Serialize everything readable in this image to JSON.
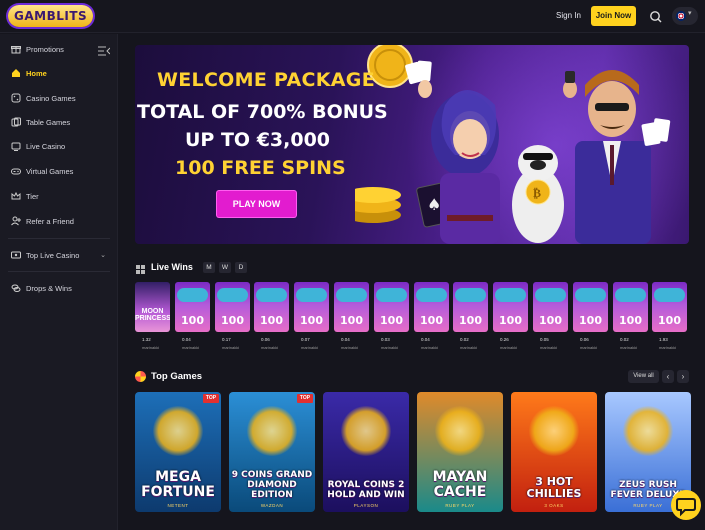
{
  "header": {
    "logo_text": "GAMBLITS",
    "signin_label": "Sign In",
    "join_label": "Join Now",
    "search_icon": "search-icon",
    "language_icon": "uk-flag-icon"
  },
  "sidebar": {
    "items": [
      {
        "label": "Promotions",
        "icon": "gift-icon"
      },
      {
        "label": "Home",
        "icon": "home-icon"
      },
      {
        "label": "Casino Games",
        "icon": "dice-icon"
      },
      {
        "label": "Table Games",
        "icon": "cards-icon"
      },
      {
        "label": "Live Casino",
        "icon": "tv-icon"
      },
      {
        "label": "Virtual Games",
        "icon": "gamepad-icon"
      },
      {
        "label": "Tier",
        "icon": "crown-icon"
      },
      {
        "label": "Refer a Friend",
        "icon": "user-plus-icon"
      },
      {
        "label": "Top Live Casino",
        "icon": "live-icon"
      },
      {
        "label": "Drops & Wins",
        "icon": "coins-icon"
      }
    ],
    "active": "Home"
  },
  "banner": {
    "line1": "WELCOME PACKAGE",
    "line2": "TOTAL OF 700% BONUS",
    "line3": "UP TO €3,000",
    "line4": "100 FREE SPINS",
    "cta": "PLAY NOW"
  },
  "live_wins": {
    "title": "Live Wins",
    "filters": [
      "M",
      "W",
      "D"
    ],
    "moon_text": "MOON PRINCESS",
    "cards": [
      {
        "game": "Moon Princess",
        "amount": "1.32",
        "user": "marinakki"
      },
      {
        "game": "100",
        "amount": "0.04",
        "user": "marinakki"
      },
      {
        "game": "100",
        "amount": "0.17",
        "user": "marinakki"
      },
      {
        "game": "100",
        "amount": "0.06",
        "user": "marinakki"
      },
      {
        "game": "100",
        "amount": "0.07",
        "user": "marinakki"
      },
      {
        "game": "100",
        "amount": "0.04",
        "user": "marinakki"
      },
      {
        "game": "100",
        "amount": "0.03",
        "user": "marinakki"
      },
      {
        "game": "100",
        "amount": "0.04",
        "user": "marinakki"
      },
      {
        "game": "100",
        "amount": "0.02",
        "user": "marinakki"
      },
      {
        "game": "100",
        "amount": "0.26",
        "user": "marinakki"
      },
      {
        "game": "100",
        "amount": "0.05",
        "user": "marinakki"
      },
      {
        "game": "100",
        "amount": "0.06",
        "user": "marinakki"
      },
      {
        "game": "100",
        "amount": "0.02",
        "user": "marinakki"
      },
      {
        "game": "100",
        "amount": "1.93",
        "user": "marinakki"
      }
    ]
  },
  "top_games": {
    "title": "Top Games",
    "view_all": "View all",
    "prev": "‹",
    "next": "›",
    "games": [
      {
        "name": "MEGA FORTUNE",
        "provider": "NETENT",
        "badge": "TOP",
        "colors": [
          "#0d3a6e",
          "#1d6fb8"
        ]
      },
      {
        "name": "9 COINS GRAND DIAMOND EDITION",
        "provider": "WAZDAN",
        "badge": "TOP",
        "colors": [
          "#0a4a7a",
          "#2b8fd6"
        ]
      },
      {
        "name": "ROYAL COINS 2 HOLD AND WIN",
        "provider": "PLAYSON",
        "badge": "",
        "colors": [
          "#1c0f5e",
          "#3a2aa8"
        ]
      },
      {
        "name": "MAYAN CACHE",
        "provider": "RUBY PLAY",
        "badge": "",
        "colors": [
          "#1a8a8a",
          "#e08a2a"
        ]
      },
      {
        "name": "3 HOT CHILLIES",
        "provider": "3 OAKS",
        "badge": "",
        "colors": [
          "#c2200f",
          "#ff7a1a"
        ]
      },
      {
        "name": "ZEUS RUSH FEVER DELUXE",
        "provider": "RUBY PLAY",
        "badge": "",
        "colors": [
          "#3a6fd6",
          "#a8c8ff"
        ]
      }
    ]
  },
  "chat_icon": "chat-bubble-icon"
}
